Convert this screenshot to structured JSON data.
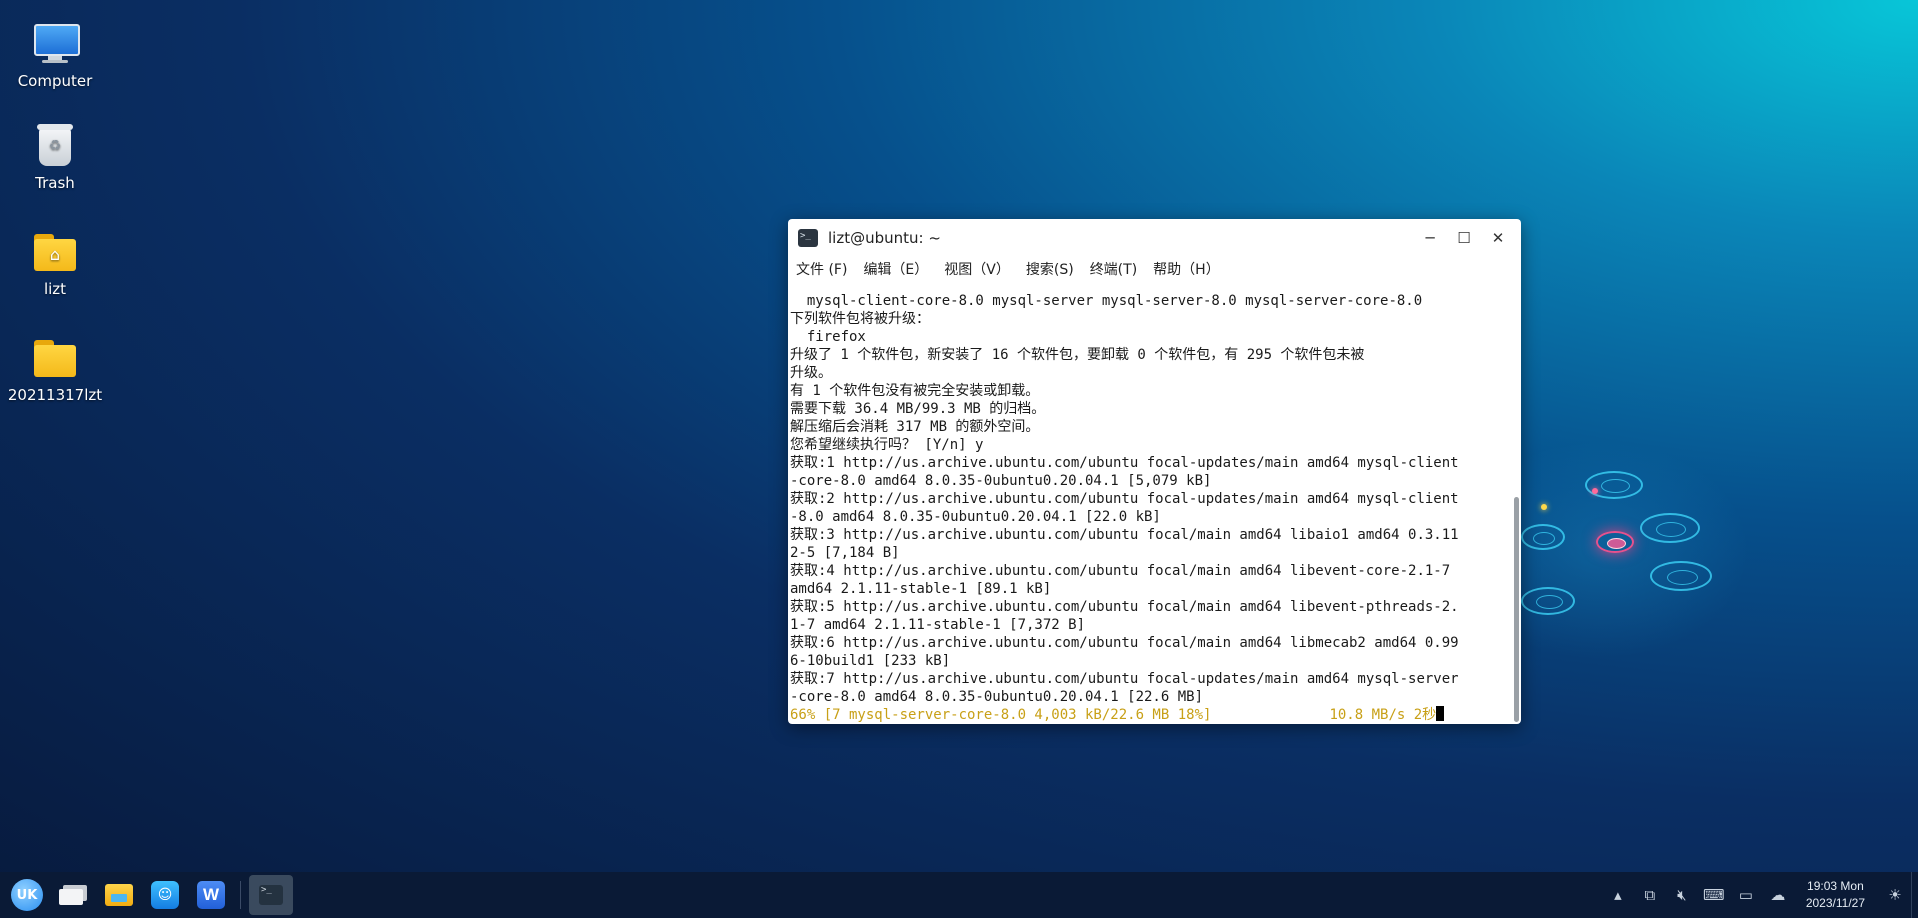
{
  "desktop": {
    "icons": [
      {
        "label": "Computer"
      },
      {
        "label": "Trash"
      },
      {
        "label": "lizt"
      },
      {
        "label": "20211317lzt"
      }
    ]
  },
  "terminal": {
    "title": "lizt@ubuntu: ~",
    "menu": [
      "文件 (F)",
      "编辑（E）",
      "视图（V）",
      "搜索(S)",
      "终端(T)",
      "帮助（H）"
    ],
    "lines": [
      "  mysql-client-core-8.0 mysql-server mysql-server-8.0 mysql-server-core-8.0",
      "下列软件包将被升级：",
      "  firefox",
      "升级了 1 个软件包，新安装了 16 个软件包，要卸载 0 个软件包，有 295 个软件包未被",
      "升级。",
      "有 1 个软件包没有被完全安装或卸载。",
      "需要下载 36.4 MB/99.3 MB 的归档。",
      "解压缩后会消耗 317 MB 的额外空间。",
      "您希望继续执行吗？ [Y/n] y",
      "获取:1 http://us.archive.ubuntu.com/ubuntu focal-updates/main amd64 mysql-client",
      "-core-8.0 amd64 8.0.35-0ubuntu0.20.04.1 [5,079 kB]",
      "获取:2 http://us.archive.ubuntu.com/ubuntu focal-updates/main amd64 mysql-client",
      "-8.0 amd64 8.0.35-0ubuntu0.20.04.1 [22.0 kB]",
      "获取:3 http://us.archive.ubuntu.com/ubuntu focal/main amd64 libaio1 amd64 0.3.11",
      "2-5 [7,184 B]",
      "获取:4 http://us.archive.ubuntu.com/ubuntu focal/main amd64 libevent-core-2.1-7",
      "amd64 2.1.11-stable-1 [89.1 kB]",
      "获取:5 http://us.archive.ubuntu.com/ubuntu focal/main amd64 libevent-pthreads-2.",
      "1-7 amd64 2.1.11-stable-1 [7,372 B]",
      "获取:6 http://us.archive.ubuntu.com/ubuntu focal/main amd64 libmecab2 amd64 0.99",
      "6-10build1 [233 kB]",
      "获取:7 http://us.archive.ubuntu.com/ubuntu focal-updates/main amd64 mysql-server",
      "-core-8.0 amd64 8.0.35-0ubuntu0.20.04.1 [22.6 MB]"
    ],
    "progress_line": "66% [7 mysql-server-core-8.0 4,003 kB/22.6 MB 18%]              10.8 MB/s 2秒",
    "progress_color": "#c8a017"
  },
  "taskbar": {
    "start_label": "UK",
    "store_glyph": "☺",
    "wps_label": "W",
    "tray_icons": [
      "chevron-up-icon",
      "network-icon",
      "volume-muted-icon",
      "keyboard-icon",
      "notification-icon",
      "cloud-icon",
      "brightness-icon"
    ],
    "clock_time": "19:03 Mon",
    "clock_date": "2023/11/27"
  }
}
